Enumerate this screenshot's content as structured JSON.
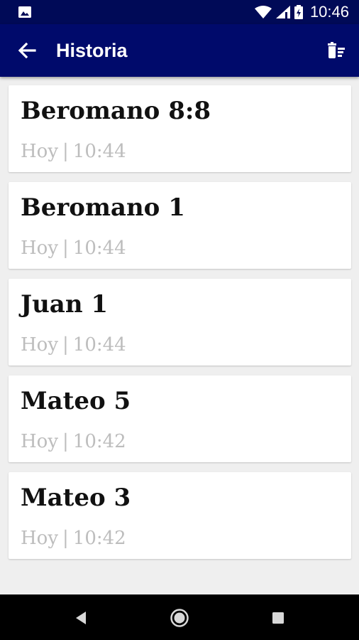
{
  "status_bar": {
    "time": "10:46",
    "icons": [
      "image-notification-icon",
      "wifi-icon",
      "signal-icon",
      "battery-icon"
    ]
  },
  "app_bar": {
    "title": "Historia",
    "back_icon": "arrow-left-icon",
    "action_icon": "delete-sweep-icon",
    "background": "#000a6b"
  },
  "history": {
    "items": [
      {
        "reference": "Beromano 8:8",
        "day": "Hoy",
        "separator": "|",
        "time": "10:44"
      },
      {
        "reference": "Beromano 1",
        "day": "Hoy",
        "separator": "|",
        "time": "10:44"
      },
      {
        "reference": "Juan 1",
        "day": "Hoy",
        "separator": "|",
        "time": "10:44"
      },
      {
        "reference": "Mateo 5",
        "day": "Hoy",
        "separator": "|",
        "time": "10:42"
      },
      {
        "reference": "Mateo 3",
        "day": "Hoy",
        "separator": "|",
        "time": "10:42"
      }
    ]
  },
  "nav_bar": {
    "icons": [
      "back-triangle-icon",
      "home-circle-icon",
      "recents-square-icon"
    ]
  }
}
